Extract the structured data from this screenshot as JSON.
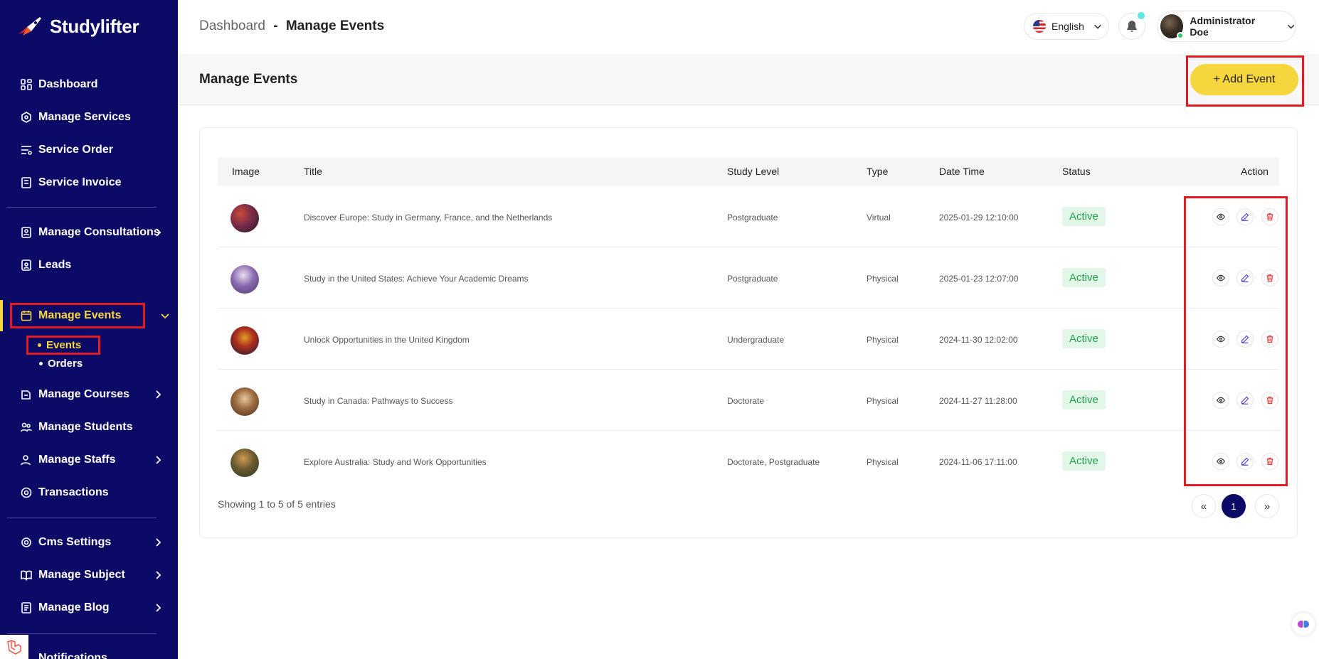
{
  "brand": {
    "name": "Studylifter"
  },
  "nav": {
    "dashboard": "Dashboard",
    "manage_services": "Manage Services",
    "service_order": "Service Order",
    "service_invoice": "Service Invoice",
    "manage_consultations": "Manage Consultations",
    "leads": "Leads",
    "manage_events": "Manage Events",
    "events": "Events",
    "orders": "Orders",
    "manage_courses": "Manage Courses",
    "manage_students": "Manage Students",
    "manage_staffs": "Manage Staffs",
    "transactions": "Transactions",
    "cms_settings": "Cms Settings",
    "manage_subject": "Manage Subject",
    "manage_blog": "Manage Blog",
    "notifications": "Notifications"
  },
  "header": {
    "breadcrumb_root": "Dashboard",
    "breadcrumb_sep": "-",
    "breadcrumb_current": "Manage Events",
    "language": "English",
    "user_name": "Administrator Doe"
  },
  "page": {
    "title": "Manage Events",
    "add_button": "+ Add Event"
  },
  "table": {
    "columns": [
      "Image",
      "Title",
      "Study Level",
      "Type",
      "Date Time",
      "Status",
      "Action"
    ],
    "rows": [
      {
        "title": "Discover Europe: Study in Germany, France, and the Netherlands",
        "level": "Postgraduate",
        "type": "Virtual",
        "datetime": "2025-01-29 12:10:00",
        "status": "Active"
      },
      {
        "title": "Study in the United States: Achieve Your Academic Dreams",
        "level": "Postgraduate",
        "type": "Physical",
        "datetime": "2025-01-23 12:07:00",
        "status": "Active"
      },
      {
        "title": "Unlock Opportunities in the United Kingdom",
        "level": "Undergraduate",
        "type": "Physical",
        "datetime": "2024-11-30 12:02:00",
        "status": "Active"
      },
      {
        "title": "Study in Canada: Pathways to Success",
        "level": "Doctorate",
        "type": "Physical",
        "datetime": "2024-11-27 11:28:00",
        "status": "Active"
      },
      {
        "title": "Explore Australia: Study and Work Opportunities",
        "level": "Doctorate, Postgraduate",
        "type": "Physical",
        "datetime": "2024-11-06 17:11:00",
        "status": "Active"
      }
    ],
    "showing": "Showing 1 to 5 of 5 entries"
  },
  "pagination": {
    "prev": "«",
    "current": "1",
    "next": "»"
  },
  "colors": {
    "sidebar": "#0c0a67",
    "accent": "#f5d63c",
    "highlight": "#e41b23",
    "status_bg": "#e3f7e9",
    "status_text": "#1fa24a"
  }
}
